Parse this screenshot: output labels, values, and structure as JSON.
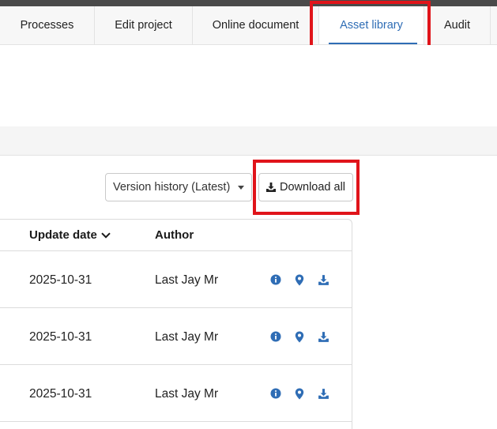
{
  "tabs": [
    {
      "label": "Processes",
      "active": false
    },
    {
      "label": "Edit project",
      "active": false
    },
    {
      "label": "Online document",
      "active": false
    },
    {
      "label": "Asset library",
      "active": true
    },
    {
      "label": "Audit",
      "active": false
    }
  ],
  "toolbar": {
    "version_select": "Version history (Latest)",
    "download_all": "Download all"
  },
  "table": {
    "columns": {
      "update_date": "Update date",
      "author": "Author"
    },
    "rows": [
      {
        "update_date": "2025-10-31",
        "author": "Last Jay Mr"
      },
      {
        "update_date": "2025-10-31",
        "author": "Last Jay Mr"
      },
      {
        "update_date": "2025-10-31",
        "author": "Last Jay Mr"
      }
    ]
  },
  "icons": {
    "info": "info-icon",
    "location": "map-pin-icon",
    "download": "download-icon"
  },
  "colors": {
    "accent": "#2f6db5",
    "highlight": "#e0141a"
  }
}
